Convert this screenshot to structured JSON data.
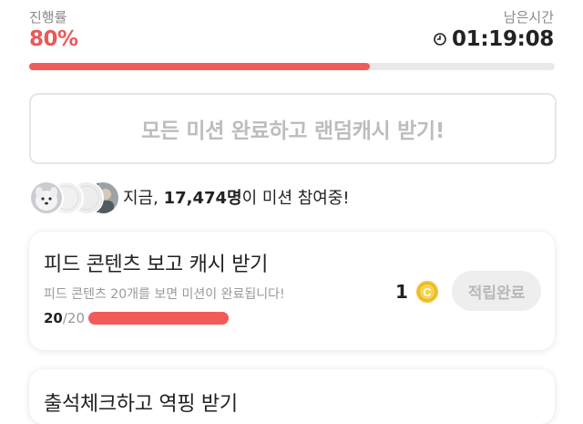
{
  "progress": {
    "label": "진행률",
    "value": "80%",
    "fraction": 0.8
  },
  "remaining": {
    "label": "남은시간",
    "time": "01:19:08",
    "icon": "clock-icon"
  },
  "reward_banner": {
    "label": "모든 미션 완료하고 랜덤캐시 받기!"
  },
  "participants": {
    "prefix": "지금,",
    "count": "17,474명",
    "suffix": "이 미션 참여중!",
    "avatars": [
      "avatar-dog",
      "avatar-blank",
      "avatar-blank",
      "avatar-person"
    ]
  },
  "missions": [
    {
      "title": "피드 콘텐츠 보고 캐시 받기",
      "description": "피드 콘텐츠 20개를 보면 미션이 완료됩니다!",
      "progress_count": "20",
      "progress_total": "/20",
      "progress_fraction": 1.0,
      "reward_amount": "1",
      "reward_icon": "coin-icon",
      "button_label": "적립완료"
    },
    {
      "title": "출석체크하고 역핑 받기"
    }
  ],
  "colors": {
    "accent": "#f35b5b",
    "progress_text": "#e85a5a",
    "coin": "#f2c230"
  }
}
